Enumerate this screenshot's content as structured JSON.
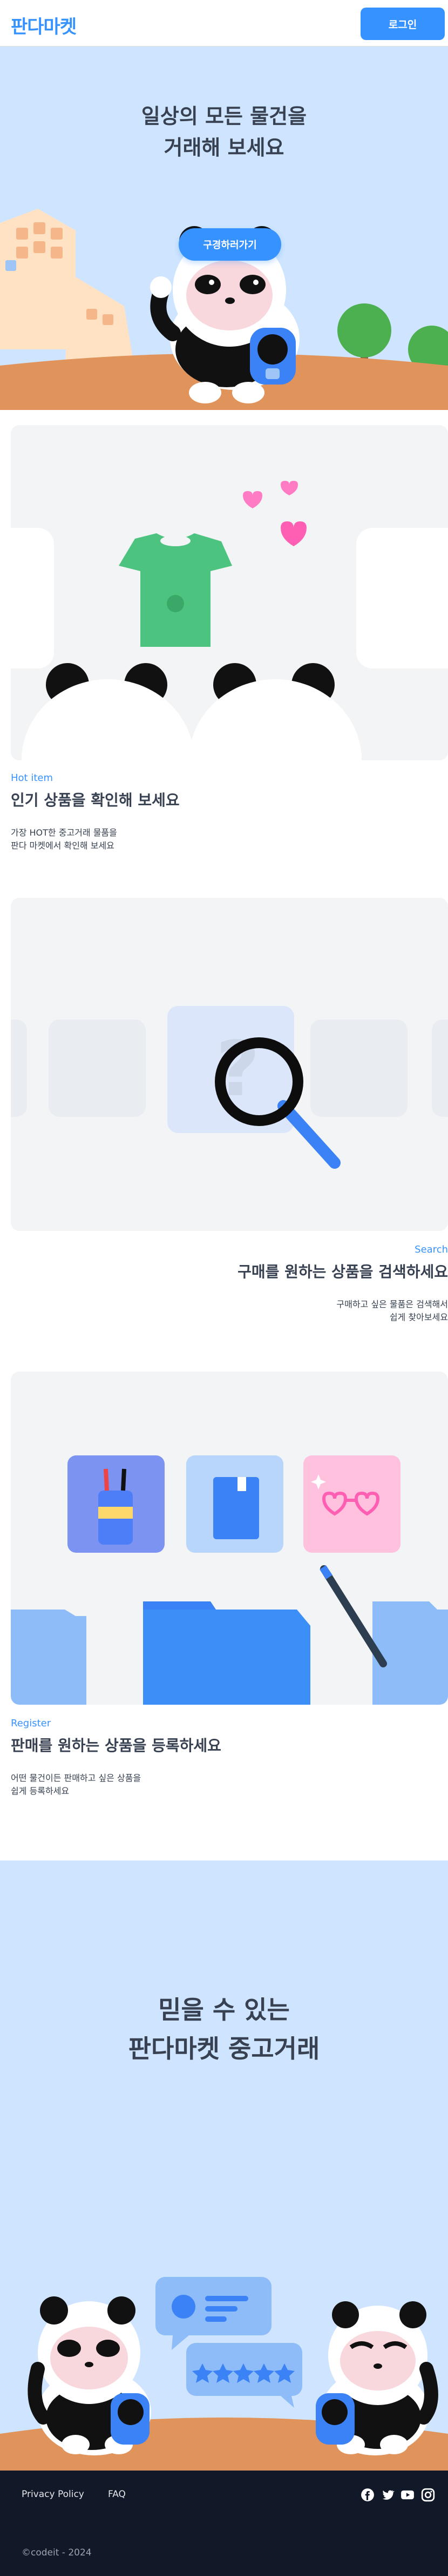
{
  "header": {
    "logo": "판다마켓",
    "login_label": "로그인"
  },
  "hero": {
    "title_line1": "일상의 모든 물건을",
    "title_line2": "거래해 보세요",
    "cta_label": "구경하러가기"
  },
  "features": [
    {
      "label": "Hot item",
      "title": "인기 상품을 확인해 보세요",
      "desc_line1": "가장 HOT한 중고거래 물품을",
      "desc_line2": "판다 마켓에서 확인해 보세요"
    },
    {
      "label": "Search",
      "title": "구매를 원하는 상품을 검색하세요",
      "desc_line1": "구매하고 싶은 물품은 검색해서",
      "desc_line2": "쉽게 찾아보세요"
    },
    {
      "label": "Register",
      "title": "판매를 원하는 상품을 등록하세요",
      "desc_line1": "어떤 물건이든 판매하고 싶은 상품을",
      "desc_line2": "쉽게 등록하세요"
    }
  ],
  "banner": {
    "title_line1": "믿을 수 있는",
    "title_line2": "판다마켓 중고거래"
  },
  "footer": {
    "privacy_label": "Privacy Policy",
    "faq_label": "FAQ",
    "copyright": "©codeit - 2024",
    "social_icons": [
      "facebook-icon",
      "twitter-icon",
      "youtube-icon",
      "instagram-icon"
    ]
  },
  "colors": {
    "brand": "#3692ff",
    "hero_bg": "#cfe5ff",
    "footer_bg": "#111827"
  }
}
